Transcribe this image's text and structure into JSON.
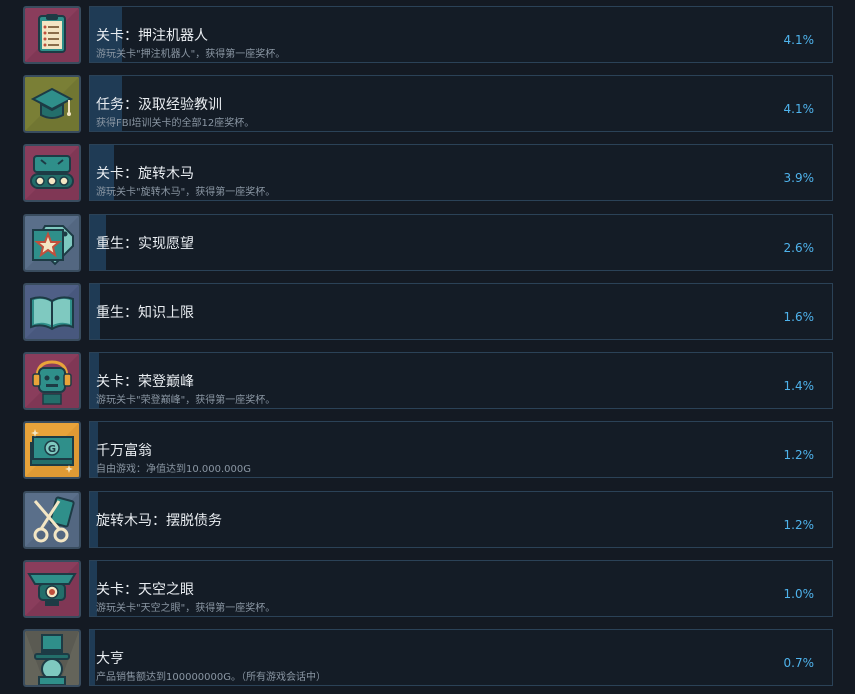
{
  "achievements": [
    {
      "title": "关卡：押注机器人",
      "desc": "游玩关卡\"押注机器人\"，获得第一座奖杯。",
      "percent": "4.1%",
      "fill": 0.041,
      "icon": "clipboard-icon",
      "bg": "#8a3d5c"
    },
    {
      "title": "任务：汲取经验教训",
      "desc": "获得FBI培训关卡的全部12座奖杯。",
      "percent": "4.1%",
      "fill": 0.041,
      "icon": "graduation-cap-icon",
      "bg": "#7a7f36"
    },
    {
      "title": "关卡：旋转木马",
      "desc": "游玩关卡\"旋转木马\"，获得第一座奖杯。",
      "percent": "3.9%",
      "fill": 0.039,
      "icon": "tank-robot-icon",
      "bg": "#8a3d5c"
    },
    {
      "title": "重生：实现愿望",
      "desc": "",
      "percent": "2.6%",
      "fill": 0.026,
      "icon": "star-tag-icon",
      "bg": "#5a6f8a"
    },
    {
      "title": "重生：知识上限",
      "desc": "",
      "percent": "1.6%",
      "fill": 0.016,
      "icon": "open-book-icon",
      "bg": "#4f5f86"
    },
    {
      "title": "关卡：荣登巅峰",
      "desc": "游玩关卡\"荣登巅峰\"，获得第一座奖杯。",
      "percent": "1.4%",
      "fill": 0.014,
      "icon": "robot-headphones-icon",
      "bg": "#8a3d5c"
    },
    {
      "title": "千万富翁",
      "desc": "自由游戏：净值达到10.000.000G",
      "percent": "1.2%",
      "fill": 0.012,
      "icon": "money-stack-icon",
      "bg": "#e8a33a"
    },
    {
      "title": "旋转木马：摆脱债务",
      "desc": "",
      "percent": "1.2%",
      "fill": 0.012,
      "icon": "scissors-card-icon",
      "bg": "#5a6f8a"
    },
    {
      "title": "关卡：天空之眼",
      "desc": "游玩关卡\"天空之眼\"，获得第一座奖杯。",
      "percent": "1.0%",
      "fill": 0.01,
      "icon": "eye-drone-icon",
      "bg": "#8a3d5c"
    },
    {
      "title": "大亨",
      "desc": "产品销售额达到100000000G。（所有游戏会话中）",
      "percent": "0.7%",
      "fill": 0.007,
      "icon": "tycoon-hat-icon",
      "bg": "#5a5a52"
    }
  ]
}
